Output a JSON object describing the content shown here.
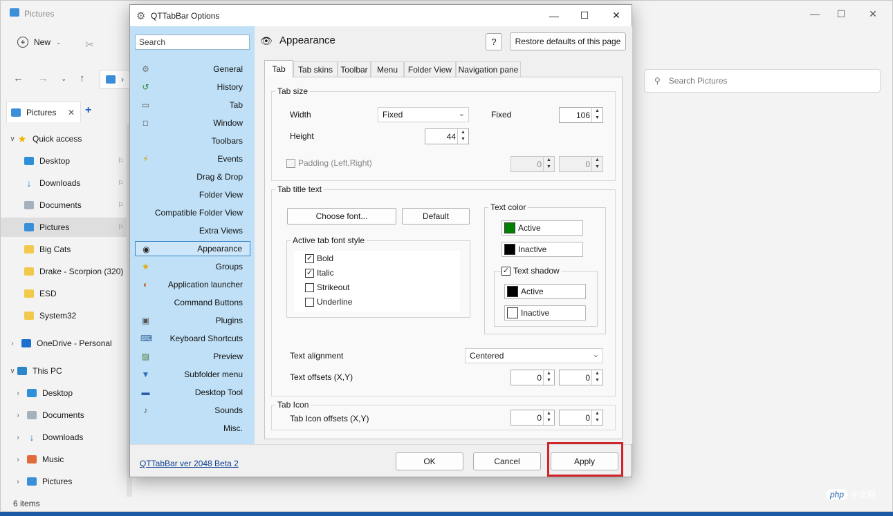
{
  "explorer": {
    "title": "Pictures",
    "toolbar": {
      "new_label": "New"
    },
    "search_placeholder": "Search Pictures",
    "tab_label": "Pictures",
    "status": "6 items",
    "tree": [
      {
        "label": "Quick access",
        "icon": "star-icon",
        "expander": "expanded",
        "pinned": false
      },
      {
        "label": "Desktop",
        "icon": "desktop-icon",
        "expander": "none",
        "pinned": true
      },
      {
        "label": "Downloads",
        "icon": "download-icon",
        "expander": "none",
        "pinned": true
      },
      {
        "label": "Documents",
        "icon": "documents-icon",
        "expander": "none",
        "pinned": true
      },
      {
        "label": "Pictures",
        "icon": "pictures-icon",
        "expander": "none",
        "pinned": true,
        "selected": true
      },
      {
        "label": "Big Cats",
        "icon": "folder-icon",
        "expander": "none",
        "pinned": false
      },
      {
        "label": "Drake - Scorpion (320)",
        "icon": "folder-icon",
        "expander": "none",
        "pinned": false
      },
      {
        "label": "ESD",
        "icon": "folder-icon",
        "expander": "none",
        "pinned": false
      },
      {
        "label": "System32",
        "icon": "folder-icon",
        "expander": "none",
        "pinned": false
      },
      {
        "label": "OneDrive - Personal",
        "icon": "onedrive-icon",
        "expander": "collapsed",
        "pinned": false
      },
      {
        "label": "This PC",
        "icon": "pc-icon",
        "expander": "expanded",
        "pinned": false
      },
      {
        "label": "Desktop",
        "icon": "desktop-icon",
        "expander": "collapsed",
        "pinned": false
      },
      {
        "label": "Documents",
        "icon": "documents-icon",
        "expander": "collapsed",
        "pinned": false
      },
      {
        "label": "Downloads",
        "icon": "download-icon",
        "expander": "collapsed",
        "pinned": false
      },
      {
        "label": "Music",
        "icon": "music-icon",
        "expander": "collapsed",
        "pinned": false
      },
      {
        "label": "Pictures",
        "icon": "pictures-icon",
        "expander": "collapsed",
        "pinned": false
      }
    ]
  },
  "dialog": {
    "title": "QTTabBar Options",
    "search_placeholder": "Search",
    "nav": [
      {
        "label": "General",
        "icon": "gear-icon"
      },
      {
        "label": "History",
        "icon": "history-icon"
      },
      {
        "label": "Tab",
        "icon": "tab-icon"
      },
      {
        "label": "Window",
        "icon": "window-icon"
      },
      {
        "label": "Toolbars",
        "icon": "none"
      },
      {
        "label": "Events",
        "icon": "lightning-icon"
      },
      {
        "label": "Drag & Drop",
        "icon": "none"
      },
      {
        "label": "Folder View",
        "icon": "none"
      },
      {
        "label": "Compatible Folder View",
        "icon": "none"
      },
      {
        "label": "Extra Views",
        "icon": "none"
      },
      {
        "label": "Appearance",
        "icon": "eye-icon",
        "active": true
      },
      {
        "label": "Groups",
        "icon": "star-icon"
      },
      {
        "label": "Application launcher",
        "icon": "launcher-icon"
      },
      {
        "label": "Command Buttons",
        "icon": "none"
      },
      {
        "label": "Plugins",
        "icon": "plugin-icon"
      },
      {
        "label": "Keyboard Shortcuts",
        "icon": "keyboard-icon"
      },
      {
        "label": "Preview",
        "icon": "preview-icon"
      },
      {
        "label": "Subfolder menu",
        "icon": "subfolder-icon"
      },
      {
        "label": "Desktop Tool",
        "icon": "desktop-tool-icon"
      },
      {
        "label": "Sounds",
        "icon": "speaker-icon"
      },
      {
        "label": "Misc.",
        "icon": "none"
      }
    ],
    "page_title": "Appearance",
    "help_label": "?",
    "restore_label": "Restore defaults of this page",
    "tabs": [
      "Tab",
      "Tab skins",
      "Toolbar",
      "Menu",
      "Folder View",
      "Navigation pane"
    ],
    "active_tab": "Tab",
    "tab_size": {
      "title": "Tab size",
      "width_label": "Width",
      "width_mode": "Fixed",
      "fixed_label": "Fixed",
      "fixed_value": "106",
      "height_label": "Height",
      "height_value": "44",
      "padding_label": "Padding (Left,Right)",
      "padding_left": "0",
      "padding_right": "0"
    },
    "tab_title_text": {
      "title": "Tab title text",
      "choose_font": "Choose font...",
      "default_btn": "Default",
      "font_style_title": "Active tab font style",
      "styles": [
        {
          "label": "Bold",
          "checked": true
        },
        {
          "label": "Italic",
          "checked": true
        },
        {
          "label": "Strikeout",
          "checked": false
        },
        {
          "label": "Underline",
          "checked": false
        }
      ],
      "text_color_title": "Text color",
      "active_label": "Active",
      "active_color": "#008000",
      "inactive_label": "Inactive",
      "inactive_color": "#000000",
      "shadow_label": "Text shadow",
      "shadow_checked": true,
      "shadow_active_label": "Active",
      "shadow_active_color": "#000000",
      "shadow_inactive_label": "Inactive",
      "shadow_inactive_color": "#ffffff",
      "alignment_label": "Text alignment",
      "alignment_value": "Centered",
      "offsets_label": "Text offsets (X,Y)",
      "offset_x": "0",
      "offset_y": "0"
    },
    "tab_icon": {
      "title": "Tab Icon",
      "offsets_label": "Tab Icon offsets (X,Y)",
      "offset_x": "0",
      "offset_y": "0"
    },
    "footer": {
      "version_link": "QTTabBar ver 2048 Beta 2",
      "ok": "OK",
      "cancel": "Cancel",
      "apply": "Apply"
    }
  },
  "colors": {
    "highlight": "#d1232a",
    "nav_bg": "#bfe0f6",
    "nav_active_border": "#3b86c8"
  },
  "watermark": {
    "pill": "php",
    "text": "中文网"
  }
}
